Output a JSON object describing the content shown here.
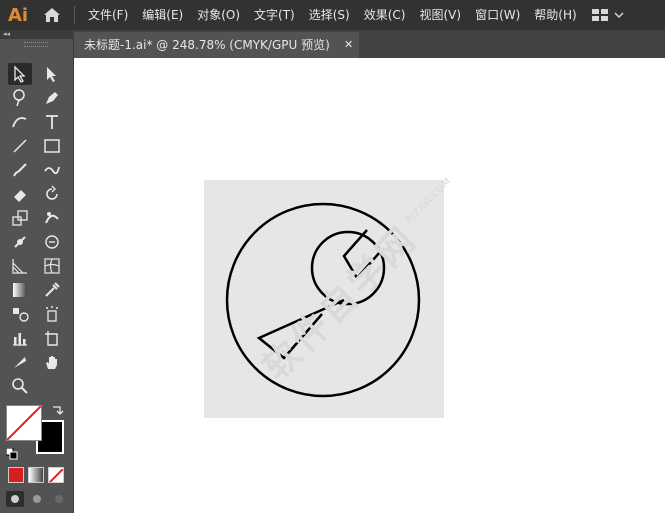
{
  "app": {
    "logo": "Ai"
  },
  "menu": [
    "文件(F)",
    "编辑(E)",
    "对象(O)",
    "文字(T)",
    "选择(S)",
    "效果(C)",
    "视图(V)",
    "窗口(W)",
    "帮助(H)"
  ],
  "document_tab": {
    "title": "未标题-1.ai* @ 248.78% (CMYK/GPU 预览)",
    "close": "✕"
  },
  "toolbar": {
    "collapse": "◂◂"
  },
  "watermark": {
    "text": "软件自学网",
    "url": "RJZXW.COM"
  },
  "colors": {
    "fill": "#ffffff",
    "stroke": "#000000",
    "accent": "#e08a35"
  }
}
